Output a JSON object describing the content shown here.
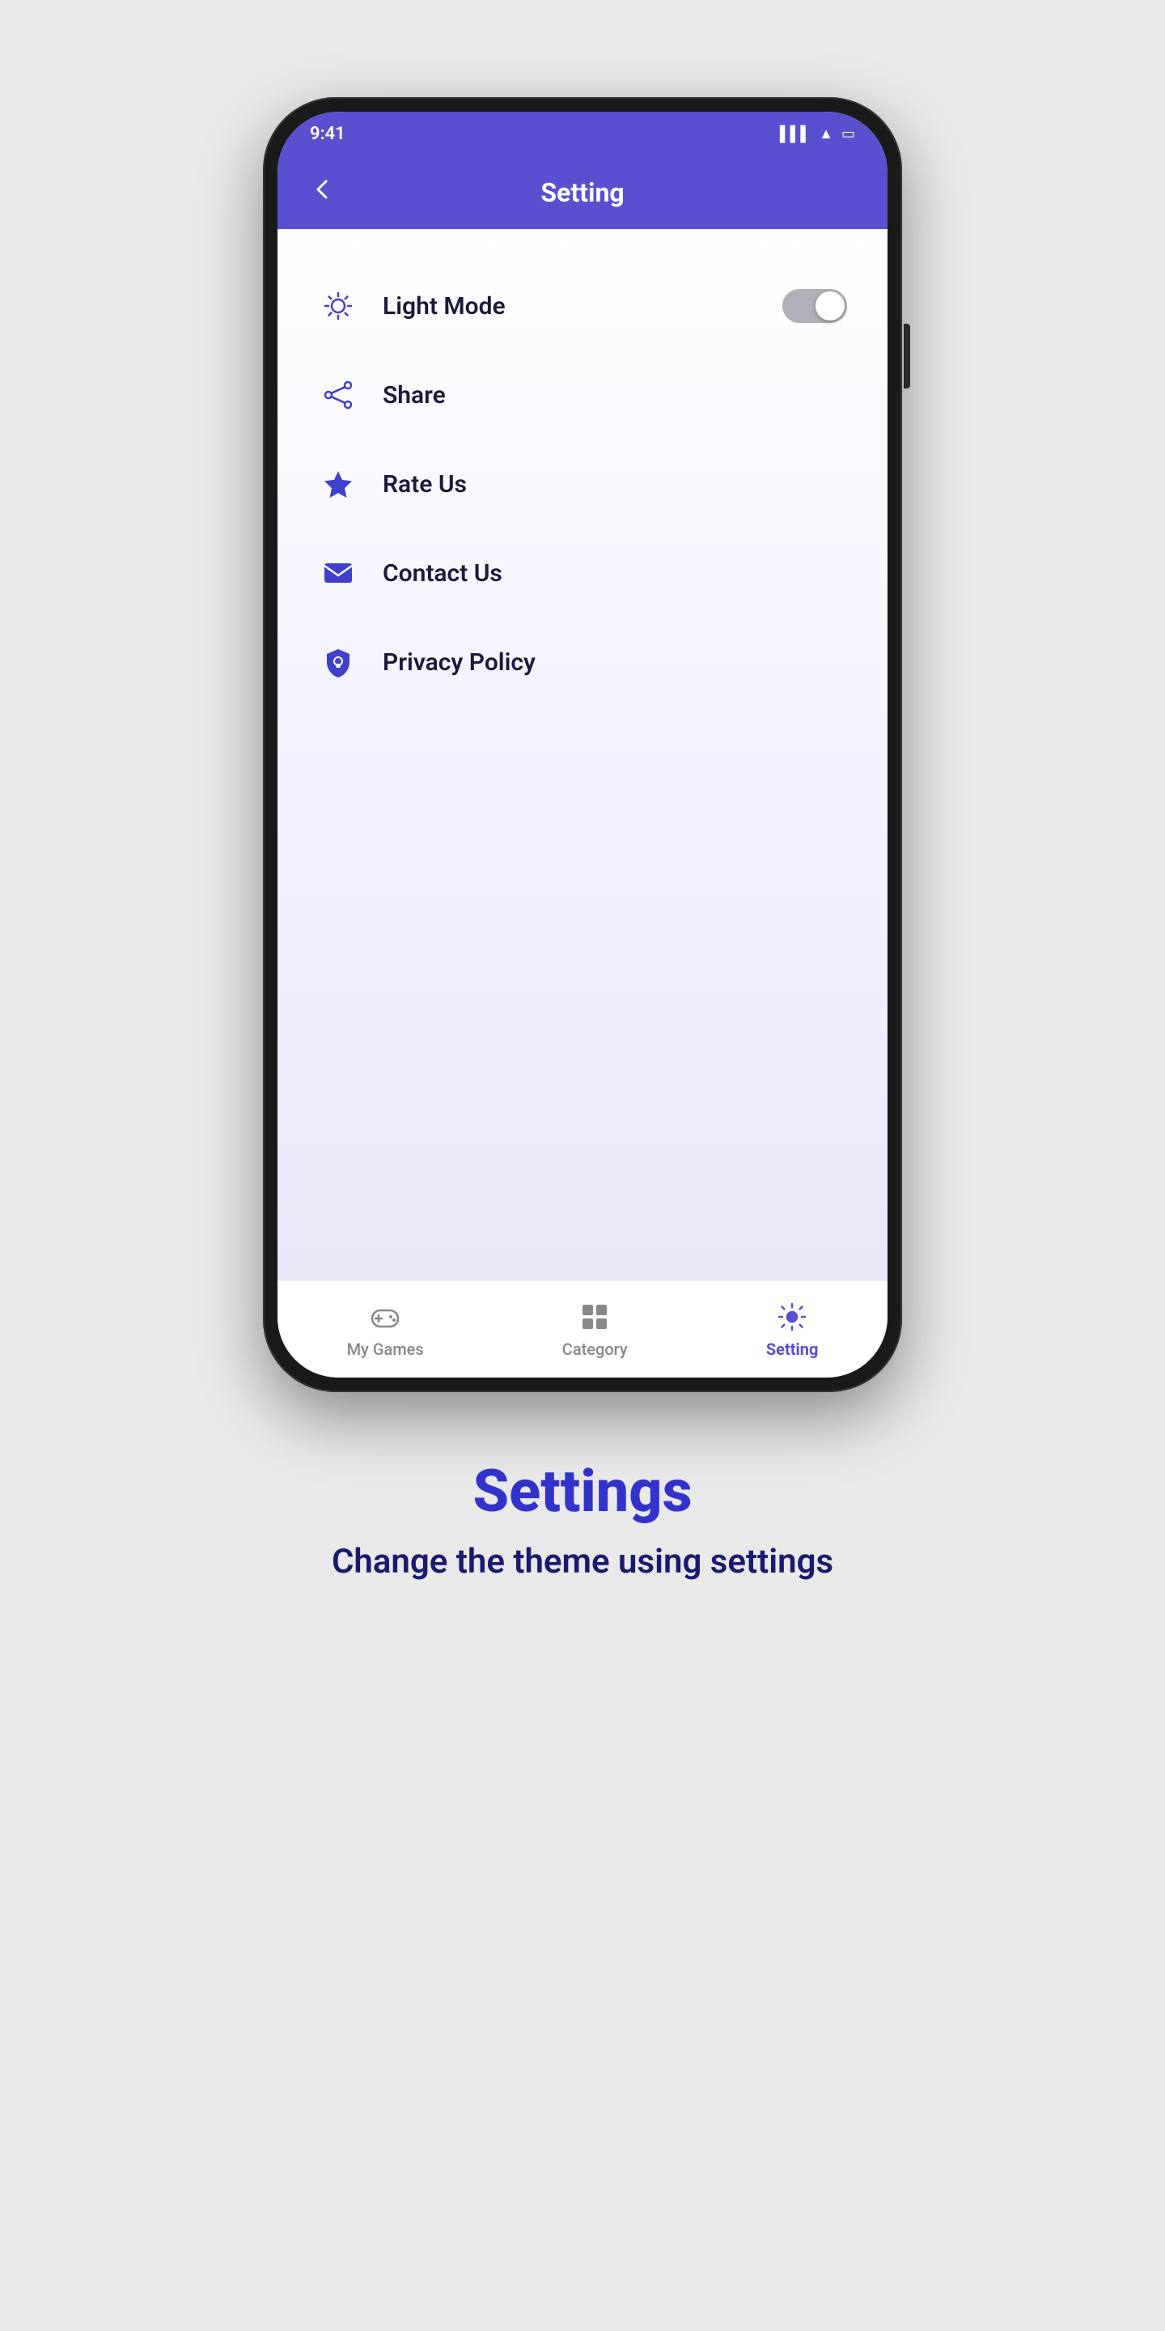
{
  "status_bar": {
    "time": "9:41"
  },
  "header": {
    "title": "Setting",
    "back_label": "←"
  },
  "settings": {
    "items": [
      {
        "id": "light-mode",
        "label": "Light Mode",
        "icon": "sun-icon",
        "has_toggle": true,
        "toggle_on": false
      },
      {
        "id": "share",
        "label": "Share",
        "icon": "share-icon",
        "has_toggle": false
      },
      {
        "id": "rate-us",
        "label": "Rate Us",
        "icon": "star-icon",
        "has_toggle": false
      },
      {
        "id": "contact-us",
        "label": "Contact Us",
        "icon": "mail-icon",
        "has_toggle": false
      },
      {
        "id": "privacy-policy",
        "label": "Privacy Policy",
        "icon": "shield-icon",
        "has_toggle": false
      }
    ]
  },
  "bottom_nav": {
    "items": [
      {
        "id": "my-games",
        "label": "My Games",
        "active": false
      },
      {
        "id": "category",
        "label": "Category",
        "active": false
      },
      {
        "id": "setting",
        "label": "Setting",
        "active": true
      }
    ]
  },
  "caption": {
    "title": "Settings",
    "subtitle": "Change the theme using settings"
  }
}
